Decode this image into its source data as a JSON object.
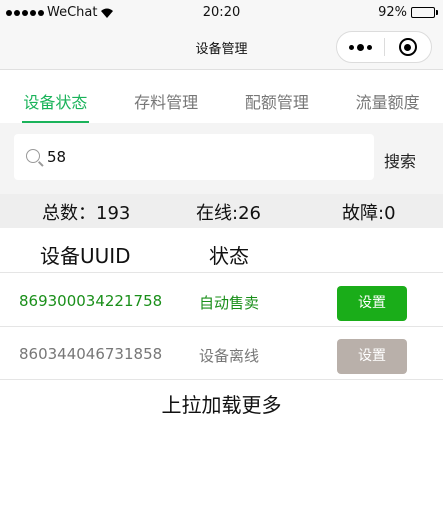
{
  "status_bar": {
    "carrier": "WeChat",
    "time": "20:20",
    "battery": "92%",
    "battery_level": 0.92
  },
  "nav": {
    "title": "设备管理"
  },
  "tabs": [
    {
      "label": "设备状态",
      "active": true
    },
    {
      "label": "存料管理",
      "active": false
    },
    {
      "label": "配额管理",
      "active": false
    },
    {
      "label": "流量额度",
      "active": false
    }
  ],
  "search": {
    "value": "58",
    "button": "搜索"
  },
  "stats": {
    "total": "总数：193",
    "online": "在线:26",
    "fault": "故障:0"
  },
  "table": {
    "headers": {
      "uuid": "设备UUID",
      "status": "状态"
    },
    "rows": [
      {
        "uuid": "869300034221758",
        "status": "自动售卖",
        "action": "设置",
        "color": "#1a8f1a",
        "button_color": "#1aad19"
      },
      {
        "uuid": "860344046731858",
        "status": "设备离线",
        "action": "设置",
        "color": "#777777",
        "button_color": "#b9b0aa"
      }
    ]
  },
  "load_more": "上拉加载更多",
  "colors": {
    "accent": "#1ab35a"
  }
}
